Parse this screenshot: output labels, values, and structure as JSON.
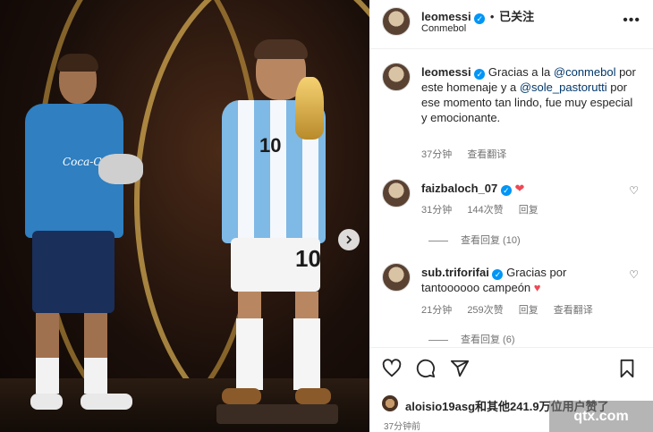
{
  "header": {
    "username": "leomessi",
    "follow_status": "已关注",
    "separator": "•",
    "location": "Conmebol",
    "more_icon": "more-horizontal-icon"
  },
  "caption": {
    "username": "leomessi",
    "text_start": "Gracias a la ",
    "mention1": "@conmebol",
    "text_mid": " por este homenaje y a ",
    "mention2": "@sole_pastorutti",
    "text_end": " por ese momento tan lindo, fue muy especial y emocionante.",
    "time": "37分钟",
    "translate": "查看翻译"
  },
  "comments": [
    {
      "username": "faizbaloch_07",
      "text": "❤",
      "time": "31分钟",
      "likes": "144次赞",
      "reply": "回复",
      "view_replies": "查看回复 (10)"
    },
    {
      "username": "sub.triforifai",
      "text_start": "Gracias por tantoooooo campeón ",
      "heart": "♥",
      "time": "21分钟",
      "likes": "259次赞",
      "reply": "回复",
      "translate": "查看翻译",
      "view_replies": "查看回复 (6)"
    }
  ],
  "photo": {
    "sponsor_text": "Coca-Cola",
    "shirt_number": "10"
  },
  "actions": {
    "like_icon": "heart-outline-icon",
    "comment_icon": "comment-icon",
    "share_icon": "share-icon",
    "save_icon": "bookmark-icon"
  },
  "likes_line": {
    "user": "aloisio19asg",
    "rest": "和其他241.9万位用户赞了"
  },
  "post_time": "37分钟前",
  "watermark": "qtx.com"
}
